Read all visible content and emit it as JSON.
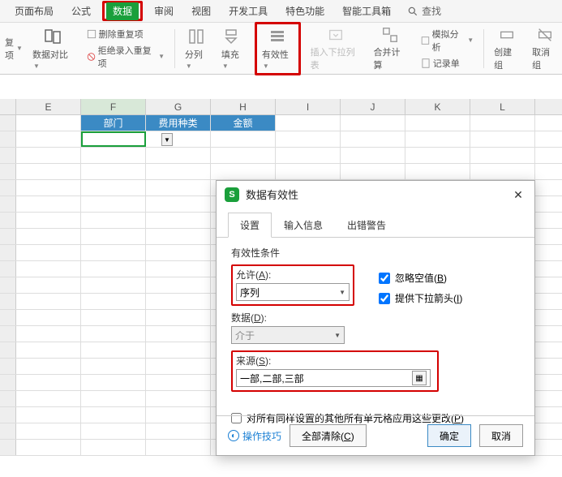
{
  "tabs": {
    "layout": "页面布局",
    "formula": "公式",
    "data": "数据",
    "review": "审阅",
    "view": "视图",
    "devtools": "开发工具",
    "features": "特色功能",
    "toolbox": "智能工具箱",
    "search": "查找"
  },
  "ribbon": {
    "hide_dup_small1": "删除重复项",
    "hide_dup_small2": "拒绝录入重复项",
    "repeat_small": "复项",
    "compare": "数据对比",
    "split": "分列",
    "fill": "填充",
    "validation": "有效性",
    "insert_dd": "插入下拉列表",
    "consolidate": "合并计算",
    "record": "记录单",
    "simulate": "模拟分析",
    "group_create": "创建组",
    "group_cancel": "取消组"
  },
  "columns": [
    "E",
    "F",
    "G",
    "H",
    "I",
    "J",
    "K",
    "L"
  ],
  "header_cells": {
    "f": "部门",
    "g": "费用种类",
    "h": "金额"
  },
  "dialog": {
    "title": "数据有效性",
    "tabs": {
      "settings": "设置",
      "input_msg": "输入信息",
      "error_alert": "出错警告"
    },
    "criteria_label": "有效性条件",
    "allow_label": "允许(A):",
    "allow_value": "序列",
    "data_label": "数据(D):",
    "data_value": "介于",
    "ignore_blank": "忽略空值(B)",
    "provide_dd": "提供下拉箭头(I)",
    "source_label": "来源(S):",
    "source_value": "一部,二部,三部",
    "apply_all": "对所有同样设置的其他所有单元格应用这些更改(P)",
    "op_tips": "操作技巧",
    "clear_all": "全部清除(C)",
    "ok": "确定",
    "cancel": "取消"
  },
  "chart_data": null
}
